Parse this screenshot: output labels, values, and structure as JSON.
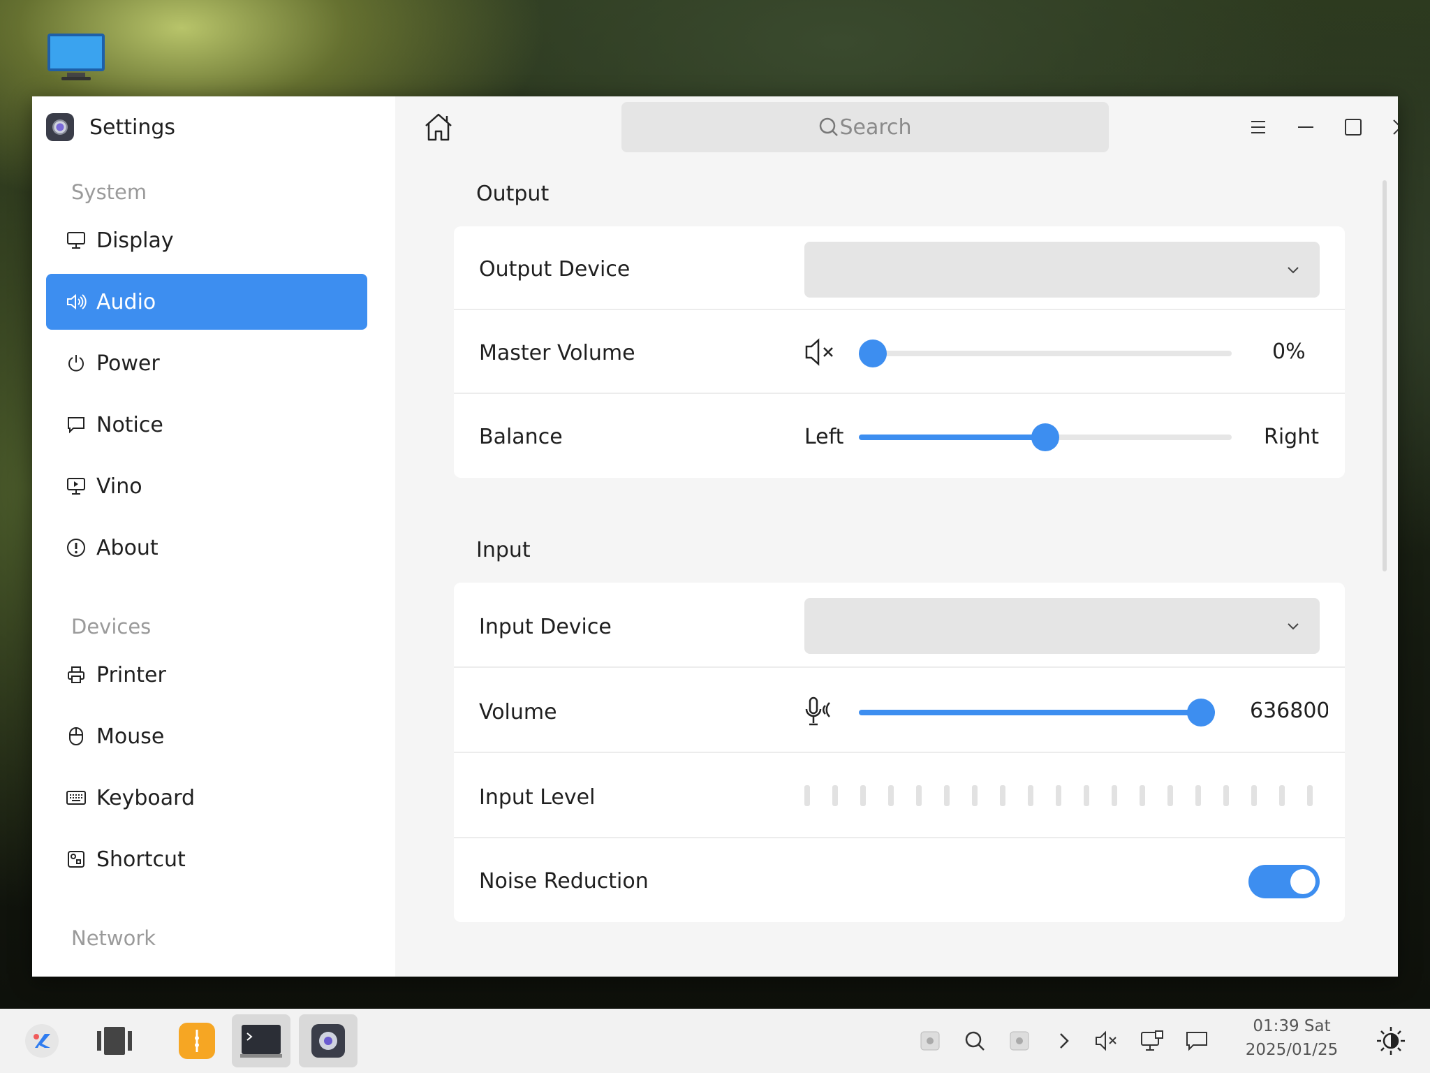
{
  "desktop": {
    "icon": "computer-icon"
  },
  "window": {
    "app_title": "Settings",
    "search_placeholder": "Search"
  },
  "sidebar": {
    "groups": [
      {
        "label": "System"
      },
      {
        "label": "Devices"
      },
      {
        "label": "Network"
      }
    ],
    "items": [
      {
        "label": "Display",
        "icon": "monitor-icon"
      },
      {
        "label": "Audio",
        "icon": "speaker-icon",
        "active": true
      },
      {
        "label": "Power",
        "icon": "power-icon"
      },
      {
        "label": "Notice",
        "icon": "chat-bubble-icon"
      },
      {
        "label": "Vino",
        "icon": "remote-desktop-icon"
      },
      {
        "label": "About",
        "icon": "info-icon"
      },
      {
        "label": "Printer",
        "icon": "printer-icon"
      },
      {
        "label": "Mouse",
        "icon": "mouse-icon"
      },
      {
        "label": "Keyboard",
        "icon": "keyboard-icon"
      },
      {
        "label": "Shortcut",
        "icon": "shortcut-icon"
      }
    ]
  },
  "output": {
    "title": "Output",
    "device_label": "Output Device",
    "device_value": "",
    "master_volume_label": "Master Volume",
    "master_volume_value": "0%",
    "master_volume_fraction": 0.0,
    "balance_label": "Balance",
    "balance_left": "Left",
    "balance_right": "Right",
    "balance_fraction": 0.5
  },
  "input": {
    "title": "Input",
    "device_label": "Input Device",
    "device_value": "",
    "volume_label": "Volume",
    "volume_value": "636800%",
    "volume_fraction": 1.0,
    "level_label": "Input Level",
    "noise_label": "Noise Reduction",
    "noise_enabled": true
  },
  "colors": {
    "accent": "#3d8ef0"
  },
  "taskbar": {
    "time": "01:39 Sat",
    "date": "2025/01/25"
  }
}
